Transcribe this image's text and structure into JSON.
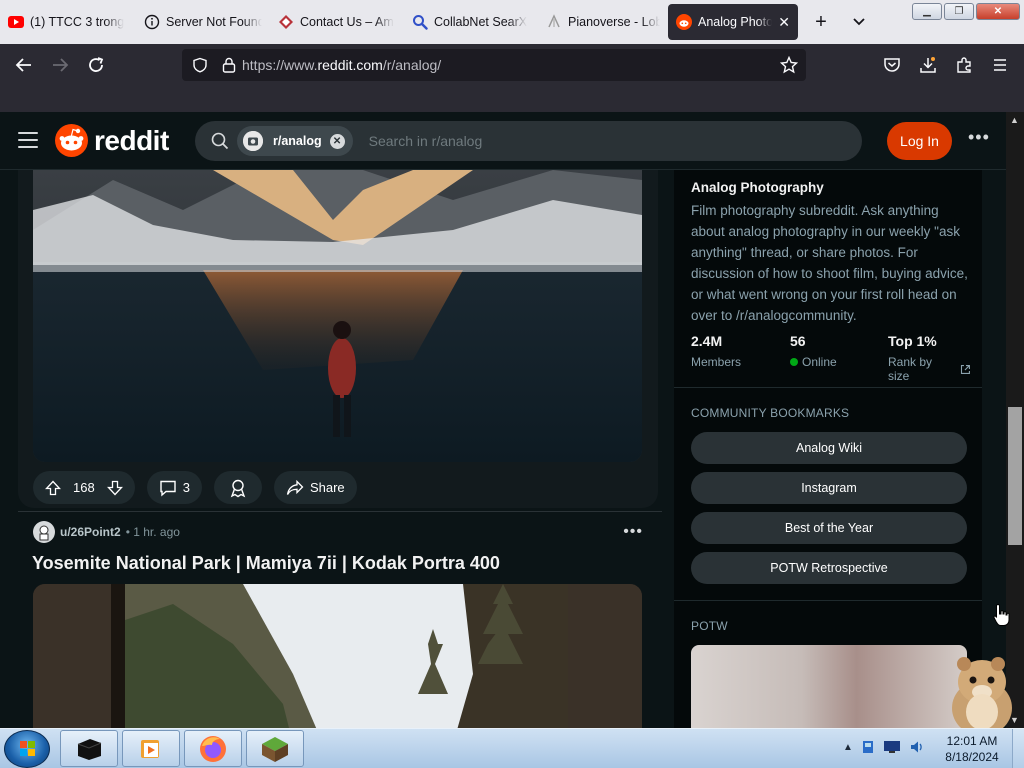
{
  "browser": {
    "tabs": [
      {
        "title": "(1) TTCC 3 trong",
        "icon": "youtube-icon"
      },
      {
        "title": "Server Not Found",
        "icon": "info-icon"
      },
      {
        "title": "Contact Us – Am",
        "icon": "site-icon"
      },
      {
        "title": "CollabNet SearX",
        "icon": "search-icon"
      },
      {
        "title": "Pianoverse - Lob",
        "icon": "pianoverse-icon"
      },
      {
        "title": "Analog Photo",
        "icon": "reddit-icon",
        "active": true
      }
    ],
    "url_prefix": "https://www.",
    "url_domain": "reddit.com",
    "url_path": "/r/analog/"
  },
  "reddit": {
    "logo_text": "reddit",
    "search_chip": "r/analog",
    "search_placeholder": "Search in r/analog",
    "login_label": "Log In"
  },
  "post1": {
    "upvotes": "168",
    "comments": "3",
    "share_label": "Share"
  },
  "post2": {
    "username": "u/26Point2",
    "time": "• 1 hr. ago",
    "title": "Yosemite National Park | Mamiya 7ii | Kodak Portra 400"
  },
  "sidebar": {
    "community_name": "Analog Photography",
    "description": "Film photography subreddit. Ask anything about analog photography in our weekly \"ask anything\" thread, or share photos. For discussion of how to shoot film, buying advice, or what went wrong on your first roll head on over to /r/analogcommunity.",
    "stats": [
      {
        "value": "2.4M",
        "label": "Members"
      },
      {
        "value": "56",
        "label": "Online"
      },
      {
        "value": "Top 1%",
        "label": "Rank by size"
      }
    ],
    "bookmarks_heading": "COMMUNITY BOOKMARKS",
    "bookmarks": [
      "Analog Wiki",
      "Instagram",
      "Best of the Year",
      "POTW Retrospective"
    ],
    "potw_heading": "POTW"
  },
  "taskbar": {
    "time": "12:01 AM",
    "date": "8/18/2024"
  },
  "colors": {
    "reddit_orange": "#ff4500",
    "login_button": "#d93900",
    "online_dot": "#01a816",
    "page_bg": "#0b1416"
  }
}
